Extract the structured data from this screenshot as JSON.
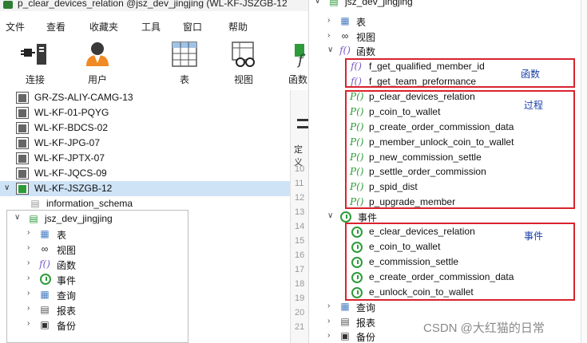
{
  "window": {
    "title": "p_clear_devices_relation @jsz_dev_jingjing (WL-KF-JSZGB-12"
  },
  "menu": [
    "文件",
    "查看",
    "收藏夹",
    "工具",
    "窗口",
    "帮助"
  ],
  "toolbar": [
    {
      "label": "连接",
      "icon": "plug-icon"
    },
    {
      "label": "用户",
      "icon": "user-icon"
    },
    {
      "label": "表",
      "icon": "table-icon"
    },
    {
      "label": "视图",
      "icon": "view-icon"
    },
    {
      "label": "函数",
      "icon": "function-icon"
    }
  ],
  "connections": [
    {
      "name": "GR-ZS-ALIY-CAMG-13",
      "active": false
    },
    {
      "name": "WL-KF-01-PQYG",
      "active": false
    },
    {
      "name": "WL-KF-BDCS-02",
      "active": false
    },
    {
      "name": "WL-KF-JPG-07",
      "active": false
    },
    {
      "name": "WL-KF-JPTX-07",
      "active": false
    },
    {
      "name": "WL-KF-JQCS-09",
      "active": false
    },
    {
      "name": "WL-KF-JSZGB-12",
      "active": true
    }
  ],
  "left_tree": {
    "schema_info": "information_schema",
    "database": "jsz_dev_jingjing",
    "nodes": [
      {
        "label": "表",
        "icon": "table-icon"
      },
      {
        "label": "视图",
        "icon": "view-icon"
      },
      {
        "label": "函数",
        "icon": "function-icon"
      },
      {
        "label": "事件",
        "icon": "event-icon"
      },
      {
        "label": "查询",
        "icon": "query-icon"
      },
      {
        "label": "报表",
        "icon": "report-icon"
      },
      {
        "label": "备份",
        "icon": "backup-icon"
      }
    ]
  },
  "editor_strip": {
    "line_numbers": [
      "10",
      "11",
      "12",
      "13",
      "14",
      "15",
      "16",
      "17",
      "18",
      "19",
      "20",
      "21"
    ],
    "tab_text": "定义"
  },
  "right_tree": {
    "database": "jsz_dev_jingjing",
    "tables_label": "表",
    "views_label": "视图",
    "functions_label": "函数",
    "functions": [
      "f_get_qualified_member_id",
      "f_get_team_preformance"
    ],
    "procedures": [
      "p_clear_devices_relation",
      "p_coin_to_wallet",
      "p_create_order_commission_data",
      "p_member_unlock_coin_to_wallet",
      "p_new_commission_settle",
      "p_settle_order_commission",
      "p_spid_dist",
      "p_upgrade_member"
    ],
    "events_label": "事件",
    "events": [
      "e_clear_devices_relation",
      "e_coin_to_wallet",
      "e_commission_settle",
      "e_create_order_commission_data",
      "e_unlock_coin_to_wallet"
    ],
    "query_label": "查询",
    "report_label": "报表",
    "backup_label": "备份"
  },
  "annotations": {
    "functions": "函数",
    "procedures": "过程",
    "events": "事件"
  },
  "watermark": "CSDN @大红猫的日常",
  "colors": {
    "annotation_box": "#d9232e",
    "annotation_text": "#1a3fa8",
    "selection": "#cfe3f7",
    "procedure_icon": "#2e9b3a",
    "function_icon": "#7b5cc4"
  }
}
